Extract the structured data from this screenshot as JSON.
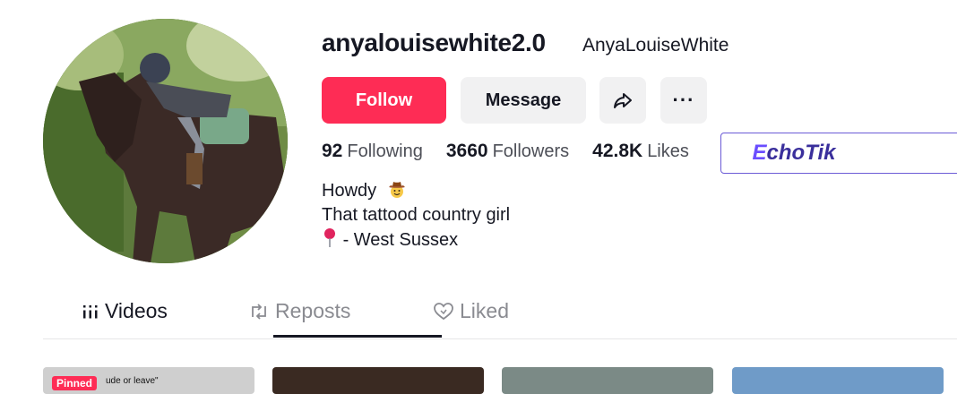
{
  "profile": {
    "username": "anyalouisewhite2.0",
    "nickname": "AnyaLouiseWhite",
    "avatar": "avatar-photo-rider-on-horse"
  },
  "actions": {
    "follow_label": "Follow",
    "message_label": "Message",
    "share_icon": "share-icon",
    "more_label": "···"
  },
  "stats": {
    "following_count": "92",
    "following_label": "Following",
    "followers_count": "3660",
    "followers_label": "Followers",
    "likes_count": "42.8K",
    "likes_label": "Likes"
  },
  "echotik": {
    "label": "EchoTik"
  },
  "bio": {
    "line1": "Howdy",
    "line2": "That tattood country girl",
    "line3": "- West Sussex"
  },
  "tabs": [
    {
      "label": "Videos",
      "icon": "grid-icon"
    },
    {
      "label": "Reposts",
      "icon": "repost-icon"
    },
    {
      "label": "Liked",
      "icon": "heart-icon"
    }
  ],
  "videos": [
    {
      "badge": "Pinned",
      "caption": "ude or leave\""
    },
    {
      "badge": "",
      "caption": ""
    },
    {
      "badge": "",
      "caption": ""
    },
    {
      "badge": "",
      "caption": ""
    }
  ],
  "colors": {
    "accent": "#fe2c55",
    "secondary_bg": "#f1f1f2",
    "text": "#161823",
    "echotik": "#3a2f9c"
  }
}
